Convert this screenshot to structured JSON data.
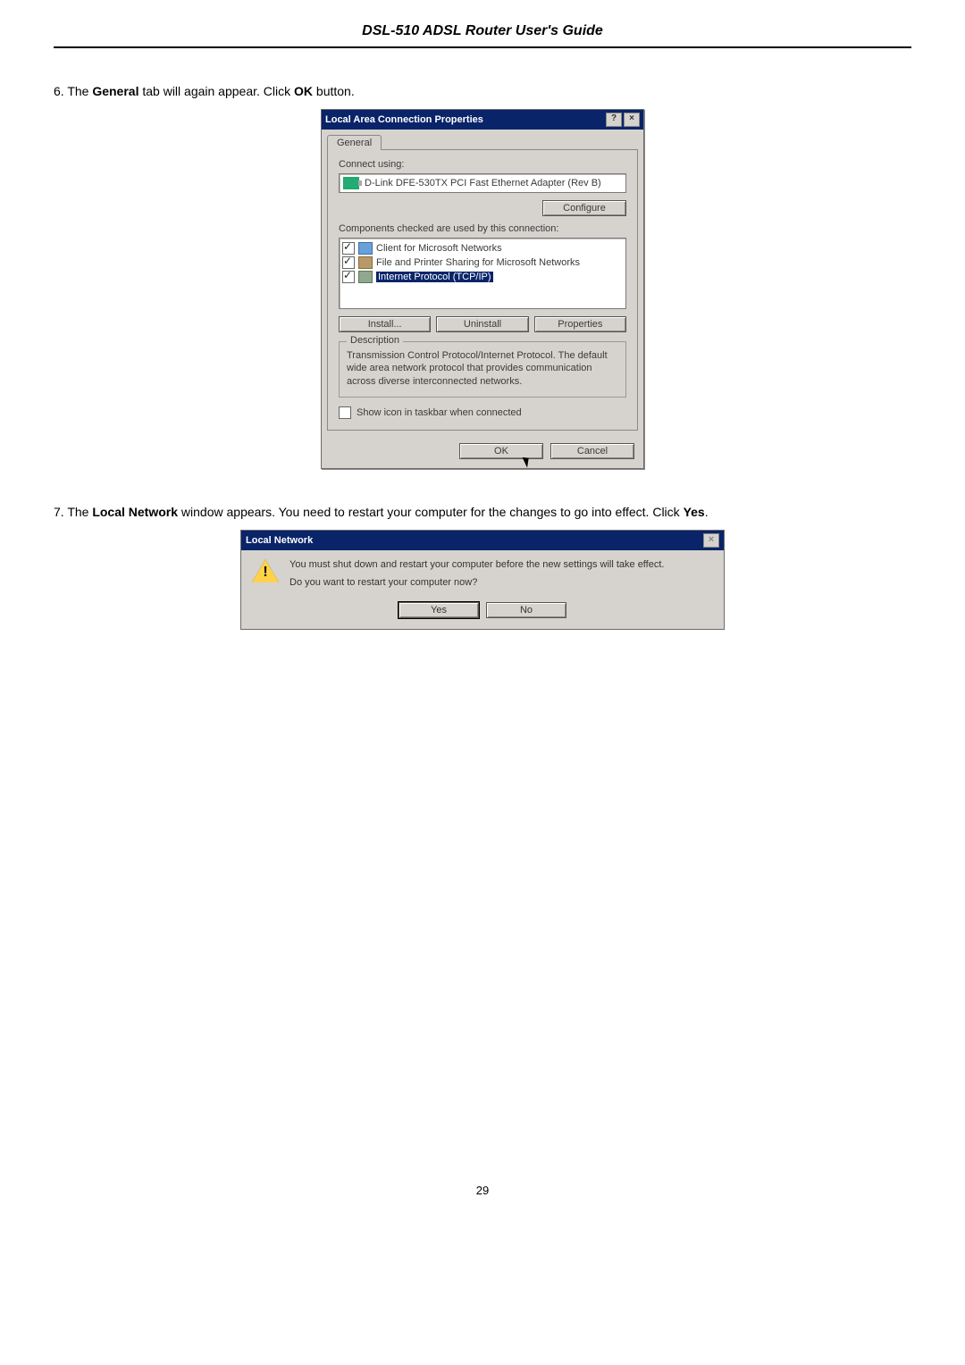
{
  "header": {
    "title": "DSL-510 ADSL Router User's Guide"
  },
  "step6": {
    "prefix": "6. The ",
    "bold1": "General",
    "mid": " tab will again appear. Click ",
    "bold2": "OK",
    "suffix": " button."
  },
  "lacp": {
    "title": "Local Area Connection Properties",
    "help_btn": "?",
    "close_btn": "×",
    "tab": "General",
    "connect_using_label": "Connect using:",
    "adapter": "D-Link DFE-530TX PCI Fast Ethernet Adapter (Rev B)",
    "configure_btn": "Configure",
    "components_label": "Components checked are used by this connection:",
    "items": [
      {
        "label": "Client for Microsoft Networks",
        "selected": false,
        "iconClass": ""
      },
      {
        "label": "File and Printer Sharing for Microsoft Networks",
        "selected": false,
        "iconClass": "printer"
      },
      {
        "label": "Internet Protocol (TCP/IP)",
        "selected": true,
        "iconClass": "tcp"
      }
    ],
    "install_btn": "Install...",
    "uninstall_btn": "Uninstall",
    "properties_btn": "Properties",
    "desc_legend": "Description",
    "desc_text": "Transmission Control Protocol/Internet Protocol. The default wide area network protocol that provides communication across diverse interconnected networks.",
    "taskbar_label": "Show icon in taskbar when connected",
    "ok_btn": "OK",
    "cancel_btn": "Cancel"
  },
  "step7": {
    "prefix": "7. The ",
    "bold1": "Local Network",
    "mid": " window appears. You need to restart your computer for the changes to go into effect. Click ",
    "bold2": "Yes",
    "suffix": "."
  },
  "msg": {
    "title": "Local Network",
    "close_btn": "×",
    "line1": "You must shut down and restart your computer before the new settings will take effect.",
    "line2": "Do you want to restart your computer now?",
    "yes_btn": "Yes",
    "no_btn": "No"
  },
  "page_number": "29"
}
